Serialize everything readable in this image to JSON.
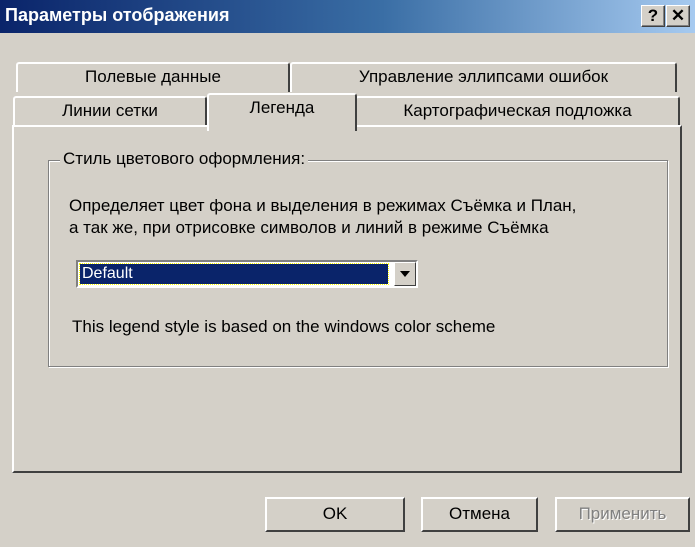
{
  "window": {
    "title": "Параметры отображения",
    "help_label": "?",
    "close_label": "✕"
  },
  "tabs": {
    "row1": [
      {
        "label": "Полевые данные"
      },
      {
        "label": "Управление эллипсами ошибок"
      }
    ],
    "row2": [
      {
        "label": "Линии сетки"
      },
      {
        "label": "Легенда",
        "active": true
      },
      {
        "label": "Картографическая подложка"
      }
    ]
  },
  "legend_tab": {
    "group_title": "Стиль цветового оформления:",
    "description_line1": "Определяет цвет фона и выделения в режимах Съёмка и План,",
    "description_line2": "а так же, при отрисовке символов и линий в режиме Съёмка",
    "style_select": {
      "selected": "Default"
    },
    "style_info": "This legend style is based on the windows color scheme"
  },
  "buttons": {
    "ok": "OK",
    "cancel": "Отмена",
    "apply": "Применить"
  },
  "colors": {
    "title_gradient_start": "#0a246a",
    "title_gradient_end": "#a6caf0",
    "face": "#d4d0c8",
    "selection": "#0a246a"
  }
}
